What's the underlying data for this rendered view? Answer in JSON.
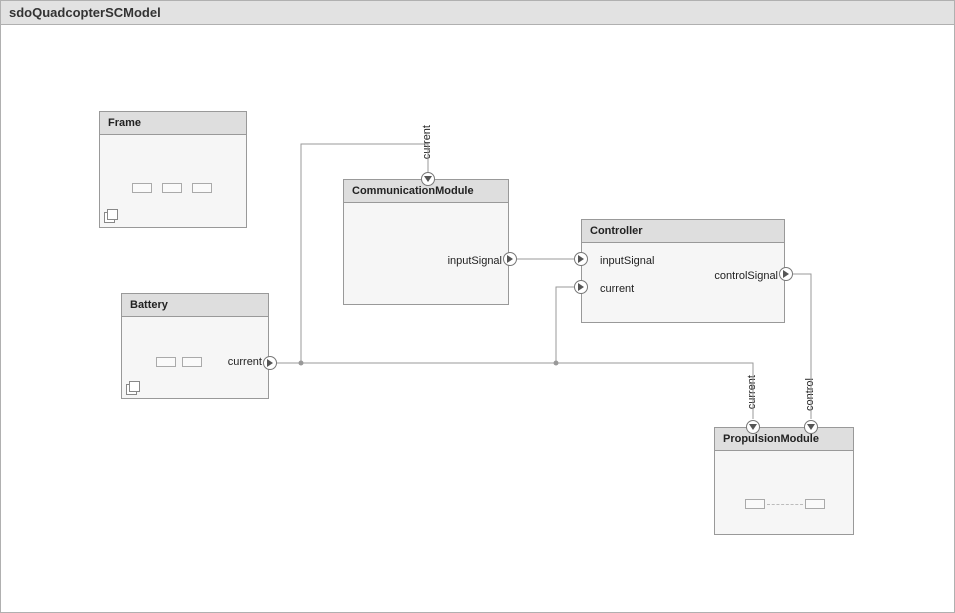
{
  "title": "sdoQuadcopterSCModel",
  "blocks": {
    "frame": {
      "name": "Frame"
    },
    "battery": {
      "name": "Battery",
      "ports": {
        "out_current": "current"
      }
    },
    "comm": {
      "name": "CommunicationModule",
      "ports": {
        "in_current": "current",
        "out_inputSignal": "inputSignal"
      }
    },
    "controller": {
      "name": "Controller",
      "ports": {
        "in_inputSignal": "inputSignal",
        "in_current": "current",
        "out_controlSignal": "controlSignal"
      }
    },
    "propulsion": {
      "name": "PropulsionModule",
      "ports": {
        "in_current": "current",
        "in_control": "control"
      }
    }
  }
}
